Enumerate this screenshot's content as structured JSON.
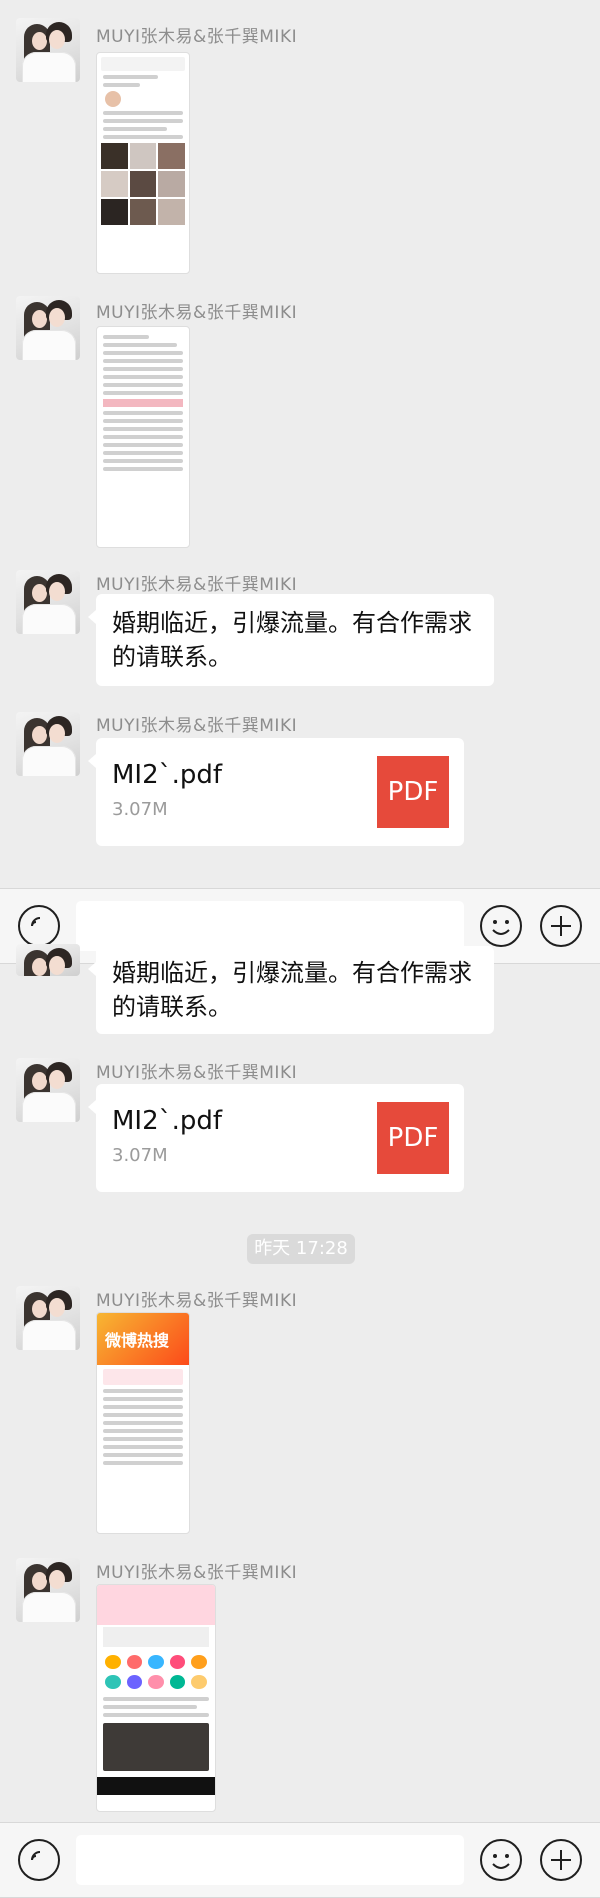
{
  "sender": "MUYI张木易&张千巽MIKI",
  "message_text": "婚期临近，引爆流量。有合作需求的请联系。",
  "file": {
    "name": "MI2`.pdf",
    "size": "3.07M",
    "icon_label": "PDF",
    "icon_color": "#e64a3b"
  },
  "time_divider": "昨天 17:28",
  "thumb_texts": {
    "hot_search_title": "微博热搜",
    "banner_title": "微博热搜"
  },
  "icons": [
    "voice-icon",
    "emoji-icon",
    "plus-icon",
    "pdf-icon"
  ]
}
